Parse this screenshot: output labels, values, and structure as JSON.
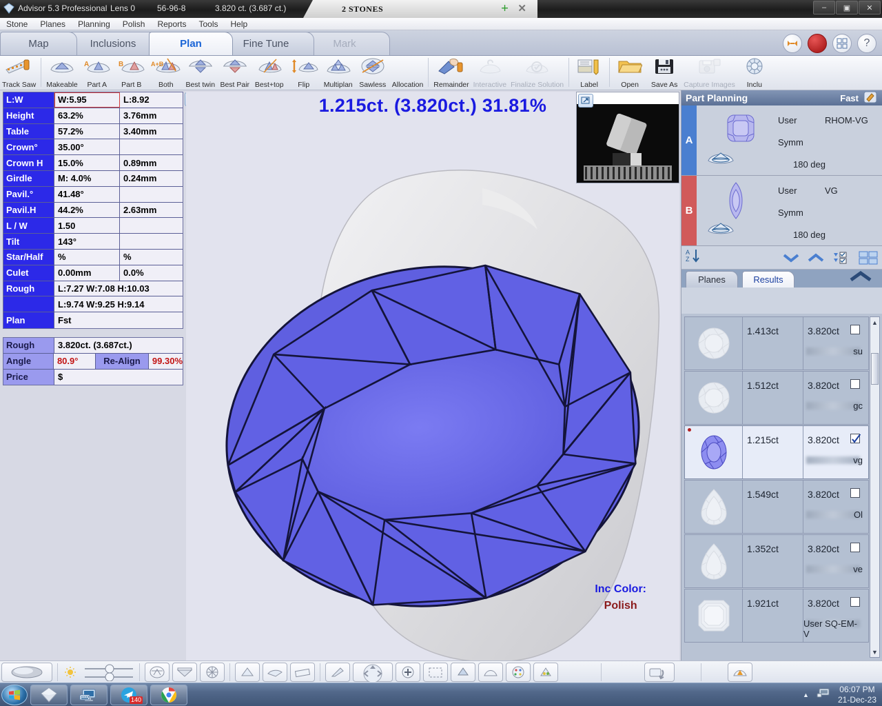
{
  "titlebar": {
    "app_title": "Advisor 5.3 Professional",
    "lens": "Lens 0",
    "stone_id": "56-96-8",
    "carat": "3.820 ct. (3.687 ct.)",
    "doc_tab": "2 STONES",
    "plus": "+",
    "close": "✕",
    "minimize": "–",
    "maximize": "▣",
    "win_close": "✕"
  },
  "menu": [
    "Stone",
    "Planes",
    "Planning",
    "Polish",
    "Reports",
    "Tools",
    "Help"
  ],
  "tabs": [
    {
      "label": "Map",
      "state": "normal"
    },
    {
      "label": "Inclusions",
      "state": "normal"
    },
    {
      "label": "Plan",
      "state": "active"
    },
    {
      "label": "Fine Tune",
      "state": "normal"
    },
    {
      "label": "Mark",
      "state": "disabled"
    }
  ],
  "tab_right_buttons": [
    "arrows-icon",
    "red-record-icon",
    "grid-icon",
    "help-icon"
  ],
  "help_glyph": "?",
  "toolbar": [
    {
      "label": "Track Saw",
      "icon": "saw-icon",
      "dim": false
    },
    {
      "label": "Makeable",
      "icon": "makeable-icon",
      "dim": false
    },
    {
      "label": "Part A",
      "icon": "part-a-icon",
      "dim": false
    },
    {
      "label": "Part B",
      "icon": "part-b-icon",
      "dim": false
    },
    {
      "label": "Both",
      "icon": "both-icon",
      "dim": false
    },
    {
      "label": "Best twin",
      "icon": "best-twin-icon",
      "dim": false
    },
    {
      "label": "Best Pair",
      "icon": "best-pair-icon",
      "dim": false
    },
    {
      "label": "Best+top",
      "icon": "best-top-icon",
      "dim": false
    },
    {
      "label": "Flip",
      "icon": "flip-icon",
      "dim": false
    },
    {
      "label": "Multiplan",
      "icon": "multiplan-icon",
      "dim": false
    },
    {
      "label": "Sawless",
      "icon": "sawless-icon",
      "dim": false
    },
    {
      "label": "Allocation",
      "icon": "allocation-icon",
      "dim": false
    },
    {
      "label": "Remainder",
      "icon": "remainder-icon",
      "dim": false
    },
    {
      "label": "Interactive",
      "icon": "interactive-icon",
      "dim": true
    },
    {
      "label": "Finalize Solution",
      "icon": "finalize-icon",
      "dim": true
    },
    {
      "label": "Label",
      "icon": "label-icon",
      "dim": false
    },
    {
      "label": "Open",
      "icon": "folder-open-icon",
      "dim": false
    },
    {
      "label": "Save As",
      "icon": "save-icon",
      "dim": false
    },
    {
      "label": "Capture Images",
      "icon": "camera-icon",
      "dim": true
    },
    {
      "label": "Inclu",
      "icon": "inclusion-icon",
      "dim": false
    }
  ],
  "measurements": [
    {
      "label": "L:W",
      "v1": "W:5.95",
      "v2": "L:8.92",
      "highlight": true
    },
    {
      "label": "Height",
      "v1": "63.2%",
      "v2": "3.76mm",
      "highlight": false
    },
    {
      "label": "Table",
      "v1": "57.2%",
      "v2": "3.40mm",
      "highlight": false
    },
    {
      "label": "Crown°",
      "v1": "35.00°",
      "v2": "",
      "highlight": false
    },
    {
      "label": "Crown H",
      "v1": "15.0%",
      "v2": "0.89mm",
      "highlight": false
    },
    {
      "label": "Girdle",
      "v1": "M: 4.0%",
      "v2": "0.24mm",
      "highlight": false
    },
    {
      "label": "Pavil.°",
      "v1": "41.48°",
      "v2": "",
      "highlight": false
    },
    {
      "label": "Pavil.H",
      "v1": "44.2%",
      "v2": "2.63mm",
      "highlight": false
    },
    {
      "label": "L / W",
      "v1": "1.50",
      "v2": "",
      "highlight": false
    },
    {
      "label": "Tilt",
      "v1": "143°",
      "v2": "",
      "highlight": false
    },
    {
      "label": "Star/Half",
      "v1": "%",
      "v2": "%",
      "highlight": false
    },
    {
      "label": "Culet",
      "v1": "0.00mm",
      "v2": "0.0%",
      "highlight": false
    }
  ],
  "rough_rows": [
    {
      "label": "Rough",
      "value": "L:7.27 W:7.08 H:10.03"
    },
    {
      "label": "",
      "value": "L:9.74 W:9.25 H:9.14"
    },
    {
      "label": "Plan",
      "value": "Fst"
    }
  ],
  "summary": {
    "rough_label": "Rough",
    "rough_value": "3.820ct. (3.687ct.)",
    "angle_label": "Angle",
    "angle_value": "80.9°",
    "realign_label": "Re-Align",
    "realign_value": "99.30%",
    "price_label": "Price",
    "price_value": "$"
  },
  "canvas": {
    "headline": "1.215ct. (3.820ct.) 31.81%",
    "inc_color_label": "Inc Color:",
    "inc_color_value": "Polish"
  },
  "part_planning": {
    "title": "Part Planning",
    "mode": "Fast",
    "rows": [
      {
        "tag": "A",
        "user": "User",
        "type": "RHOM-VG",
        "symm": "Symm",
        "deg": "180 deg",
        "shape": "cushion-gem-icon"
      },
      {
        "tag": "B",
        "user": "User",
        "type": "VG",
        "symm": "Symm",
        "deg": "180 deg",
        "shape": "marquise-gem-icon"
      }
    ]
  },
  "list_tabs": [
    {
      "label": "Planes",
      "active": false
    },
    {
      "label": "Results",
      "active": true
    }
  ],
  "results": [
    {
      "ct": "1.413ct",
      "rough": "3.820ct",
      "checked": false,
      "tail": "su",
      "shape": "round-brilliant-icon",
      "selected": false
    },
    {
      "ct": "1.512ct",
      "rough": "3.820ct",
      "checked": false,
      "tail": "gc",
      "shape": "round-brilliant-icon",
      "selected": false
    },
    {
      "ct": "1.215ct",
      "rough": "3.820ct",
      "checked": true,
      "tail": "vg",
      "shape": "oval-brilliant-icon",
      "selected": true
    },
    {
      "ct": "1.549ct",
      "rough": "3.820ct",
      "checked": false,
      "tail": "Ol",
      "shape": "pear-icon",
      "selected": false
    },
    {
      "ct": "1.352ct",
      "rough": "3.820ct",
      "checked": false,
      "tail": "ve",
      "shape": "pear-icon",
      "selected": false
    },
    {
      "ct": "1.921ct",
      "rough": "3.820ct",
      "checked": false,
      "tail": "User SQ-EM-V",
      "shape": "emerald-cut-icon",
      "selected": false
    }
  ],
  "taskbar": {
    "start": "windows-logo-icon",
    "items": [
      {
        "icon": "diamond-app-icon",
        "badge": ""
      },
      {
        "icon": "computer-icon",
        "badge": ""
      },
      {
        "icon": "telegram-icon",
        "badge": "140"
      },
      {
        "icon": "chrome-icon",
        "badge": ""
      }
    ],
    "tray_chevron": "▲",
    "tray_network": "network-icon",
    "time": "06:07 PM",
    "date": "21-Dec-23"
  },
  "colors": {
    "label_blue": "#2c29e8",
    "accent_blue": "#1a1ae0",
    "gem_blue": "#5b5be0",
    "red": "#c21414",
    "tag_a": "#4a7fd0",
    "tag_b": "#d15a5a"
  }
}
